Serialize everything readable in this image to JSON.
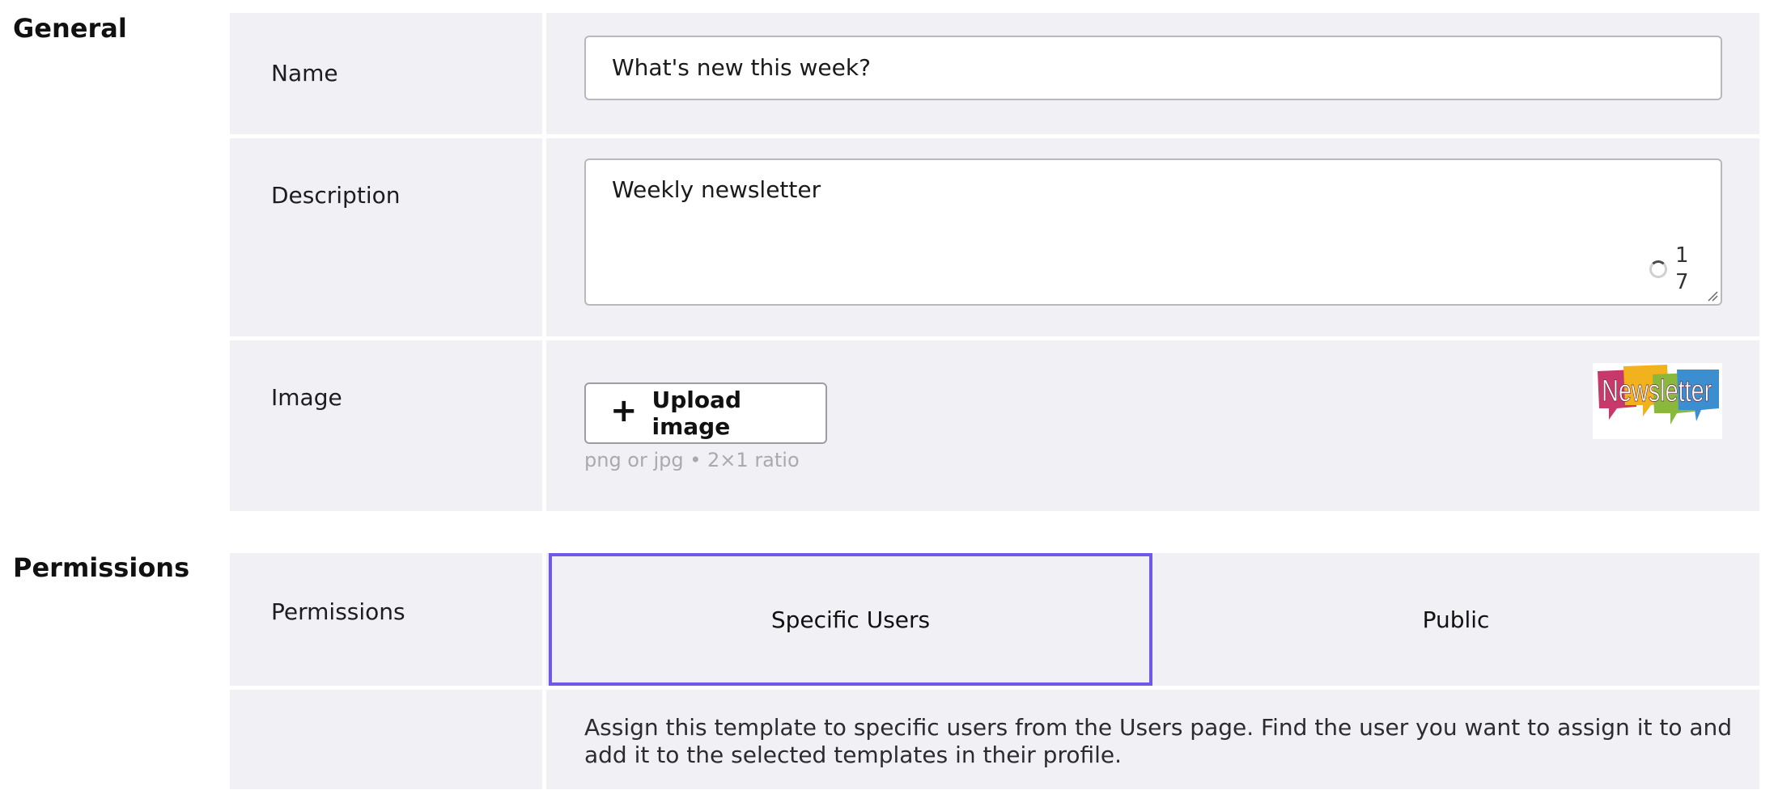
{
  "general": {
    "heading": "General",
    "name": {
      "label": "Name",
      "value": "What's new this week?"
    },
    "description": {
      "label": "Description",
      "value": "Weekly newsletter",
      "char_count": "17"
    },
    "image": {
      "label": "Image",
      "upload_button_label": "Upload image",
      "upload_icon": "plus-icon",
      "hint": "png or jpg • 2×1 ratio",
      "preview_text": "Newsletter"
    }
  },
  "permissions": {
    "heading": "Permissions",
    "label": "Permissions",
    "options": [
      {
        "label": "Specific Users",
        "selected": true
      },
      {
        "label": "Public",
        "selected": false
      }
    ],
    "help_text": "Assign this template to specific users from the Users page. Find the user you want to assign it to and add it to the selected templates in their profile."
  },
  "colors": {
    "panel_background": "#f0f0f5",
    "selected_border": "#7058e8"
  }
}
